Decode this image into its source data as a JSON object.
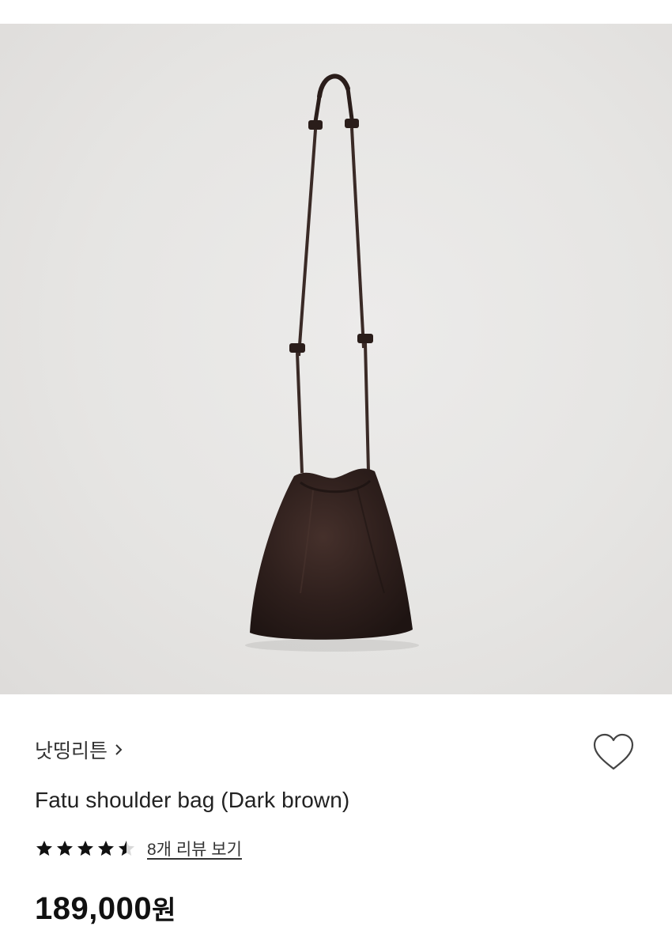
{
  "product": {
    "brand_name": "낫띵리튼",
    "title": "Fatu shoulder bag (Dark brown)",
    "rating": 4.5,
    "review_link_text": "8개 리뷰 보기",
    "price_value": "189,000",
    "price_currency": "원"
  },
  "colors": {
    "bag": "#2e1f1c",
    "background": "#e7e6e4",
    "text_primary": "#111111",
    "text_secondary": "#333333"
  },
  "icons": {
    "brand_chevron": "chevron-right-icon",
    "wishlist": "heart-outline-icon",
    "rating": "star-icon"
  }
}
